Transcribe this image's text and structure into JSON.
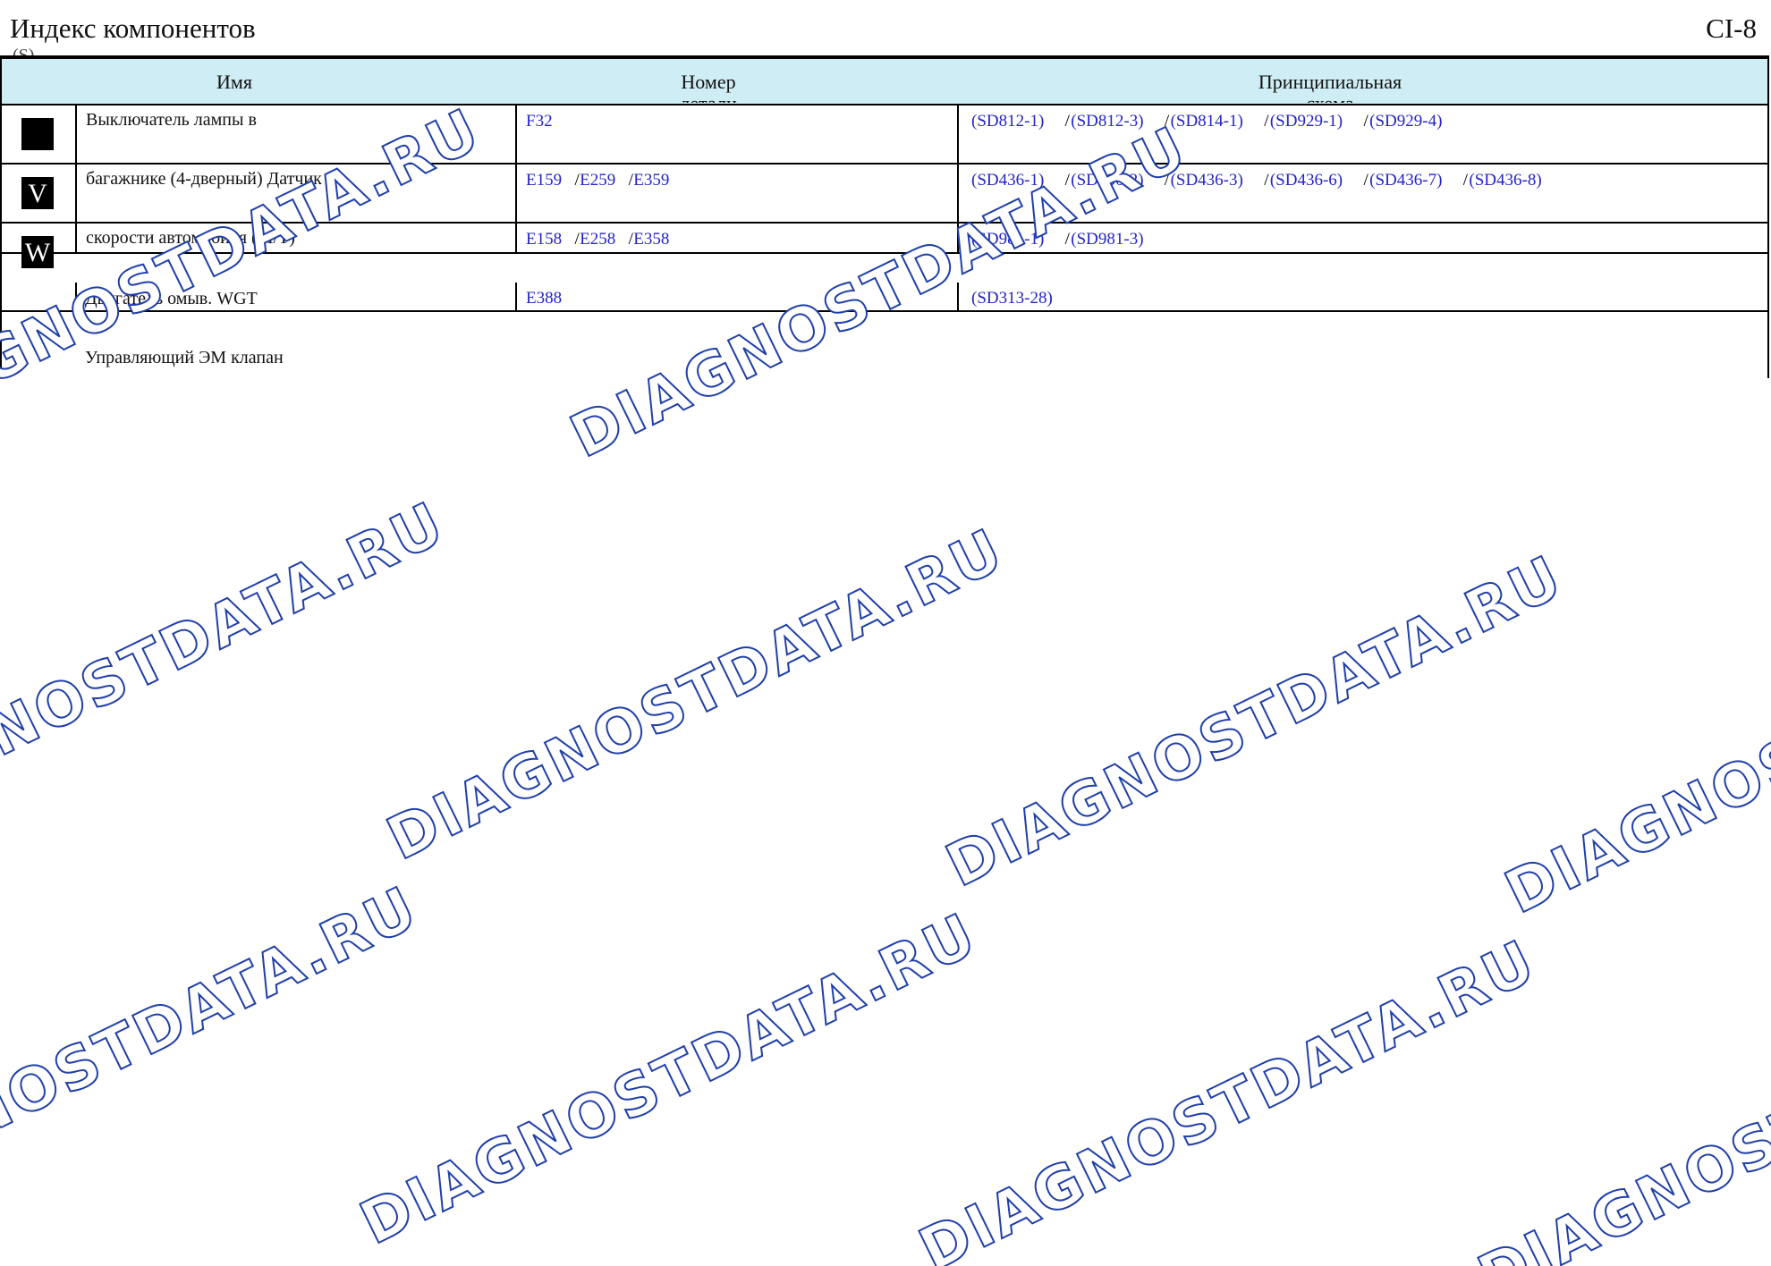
{
  "header": {
    "title": "Индекс компонентов",
    "subtitle": "(S)",
    "page_number": "CI-8"
  },
  "table": {
    "columns": {
      "name": "Имя",
      "part_line1": "Номер",
      "part_line2": "детали",
      "schema_line1": "Принципиальная",
      "schema_line2": "схема"
    },
    "rows": [
      {
        "symbol": "",
        "name": "Выключатель лампы в",
        "parts": [
          "F32"
        ],
        "schemas": [
          "(SD812-1)",
          "(SD812-3)",
          "(SD814-1)",
          "(SD929-1)",
          "(SD929-4)"
        ]
      },
      {
        "symbol": "V",
        "name": "багажнике (4-дверный) Датчик",
        "parts": [
          "E159",
          "E259",
          "E359"
        ],
        "schemas": [
          "(SD436-1)",
          "(SD436-2)",
          "(SD436-3)",
          "(SD436-6)",
          "(SD436-7)",
          "(SD436-8)"
        ]
      },
      {
        "symbol": "W",
        "name": "скорости автомобиля (M/T)",
        "parts": [
          "E158",
          "E258",
          "E358"
        ],
        "schemas": [
          "(SD981-1)",
          "(SD981-3)"
        ]
      },
      {
        "symbol": "",
        "name": "",
        "parts": [
          "E388"
        ],
        "schemas": [
          "(SD313-28)"
        ]
      }
    ],
    "loose_lines": [
      "Двигатель омыв. WGT",
      "Управляющий ЭМ клапан"
    ]
  },
  "watermark": {
    "text": "DIAGNOSTDATA.RU",
    "color": "#1f3fa8"
  },
  "colors": {
    "header_bg": "#cfedf4",
    "link": "#2424c8"
  }
}
